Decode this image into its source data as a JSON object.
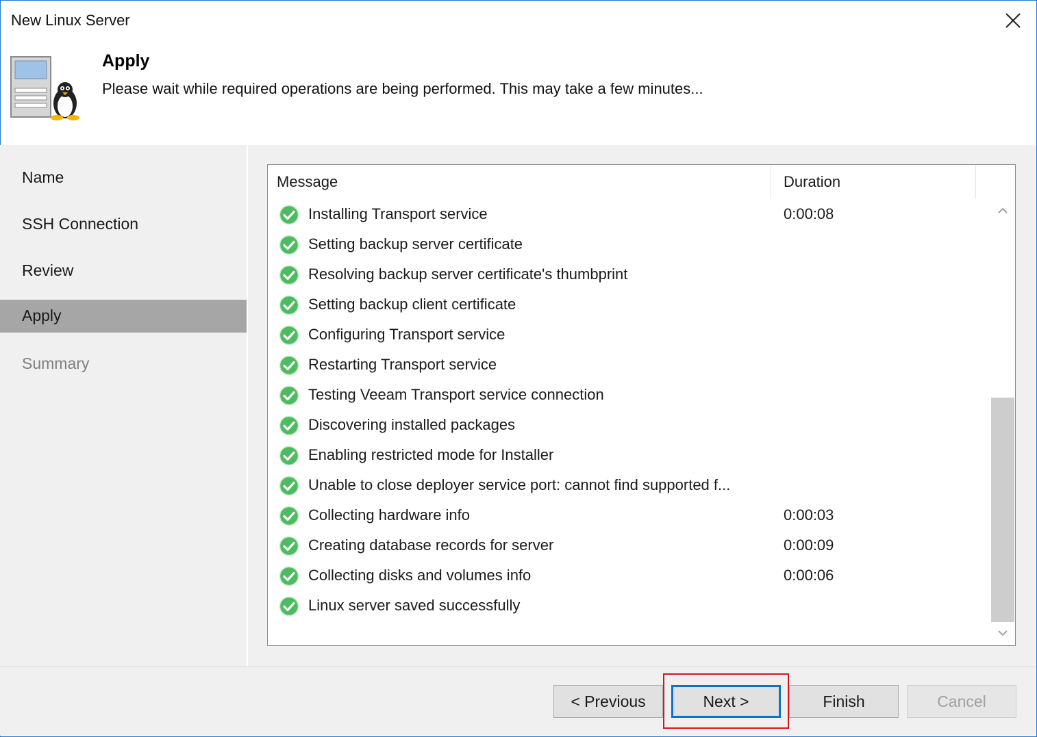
{
  "window": {
    "title": "New Linux Server",
    "step_title": "Apply",
    "step_description": "Please wait while required operations are being performed. This may take a few minutes..."
  },
  "sidebar": {
    "items": [
      {
        "label": "Name",
        "state": "normal"
      },
      {
        "label": "SSH Connection",
        "state": "normal"
      },
      {
        "label": "Review",
        "state": "normal"
      },
      {
        "label": "Apply",
        "state": "active"
      },
      {
        "label": "Summary",
        "state": "disabled"
      }
    ]
  },
  "log": {
    "headers": {
      "message": "Message",
      "duration": "Duration"
    },
    "rows": [
      {
        "status": "success",
        "message": "Installing Transport service",
        "duration": "0:00:08"
      },
      {
        "status": "success",
        "message": "Setting backup server certificate",
        "duration": ""
      },
      {
        "status": "success",
        "message": "Resolving backup server certificate's thumbprint",
        "duration": ""
      },
      {
        "status": "success",
        "message": "Setting backup client certificate",
        "duration": ""
      },
      {
        "status": "success",
        "message": "Configuring Transport service",
        "duration": ""
      },
      {
        "status": "success",
        "message": "Restarting Transport service",
        "duration": ""
      },
      {
        "status": "success",
        "message": "Testing Veeam Transport service connection",
        "duration": ""
      },
      {
        "status": "success",
        "message": "Discovering installed packages",
        "duration": ""
      },
      {
        "status": "success",
        "message": "Enabling restricted mode for Installer",
        "duration": ""
      },
      {
        "status": "success",
        "message": "Unable to close deployer service port: cannot find supported f...",
        "duration": ""
      },
      {
        "status": "success",
        "message": "Collecting hardware info",
        "duration": "0:00:03"
      },
      {
        "status": "success",
        "message": "Creating database records for server",
        "duration": "0:00:09"
      },
      {
        "status": "success",
        "message": "Collecting disks and volumes info",
        "duration": "0:00:06"
      },
      {
        "status": "success",
        "message": "Linux server saved successfully",
        "duration": ""
      }
    ]
  },
  "buttons": {
    "previous": "< Previous",
    "next": "Next >",
    "finish": "Finish",
    "cancel": "Cancel"
  },
  "icons": {
    "close": "close-icon",
    "header": "linux-server-icon",
    "status": "check-circle-icon"
  },
  "colors": {
    "window_border": "#1e78d2",
    "active_nav": "#a6a6a6",
    "success": "#4dbb5f",
    "primary_button_border": "#0a74c8",
    "highlight": "#d9151b"
  }
}
